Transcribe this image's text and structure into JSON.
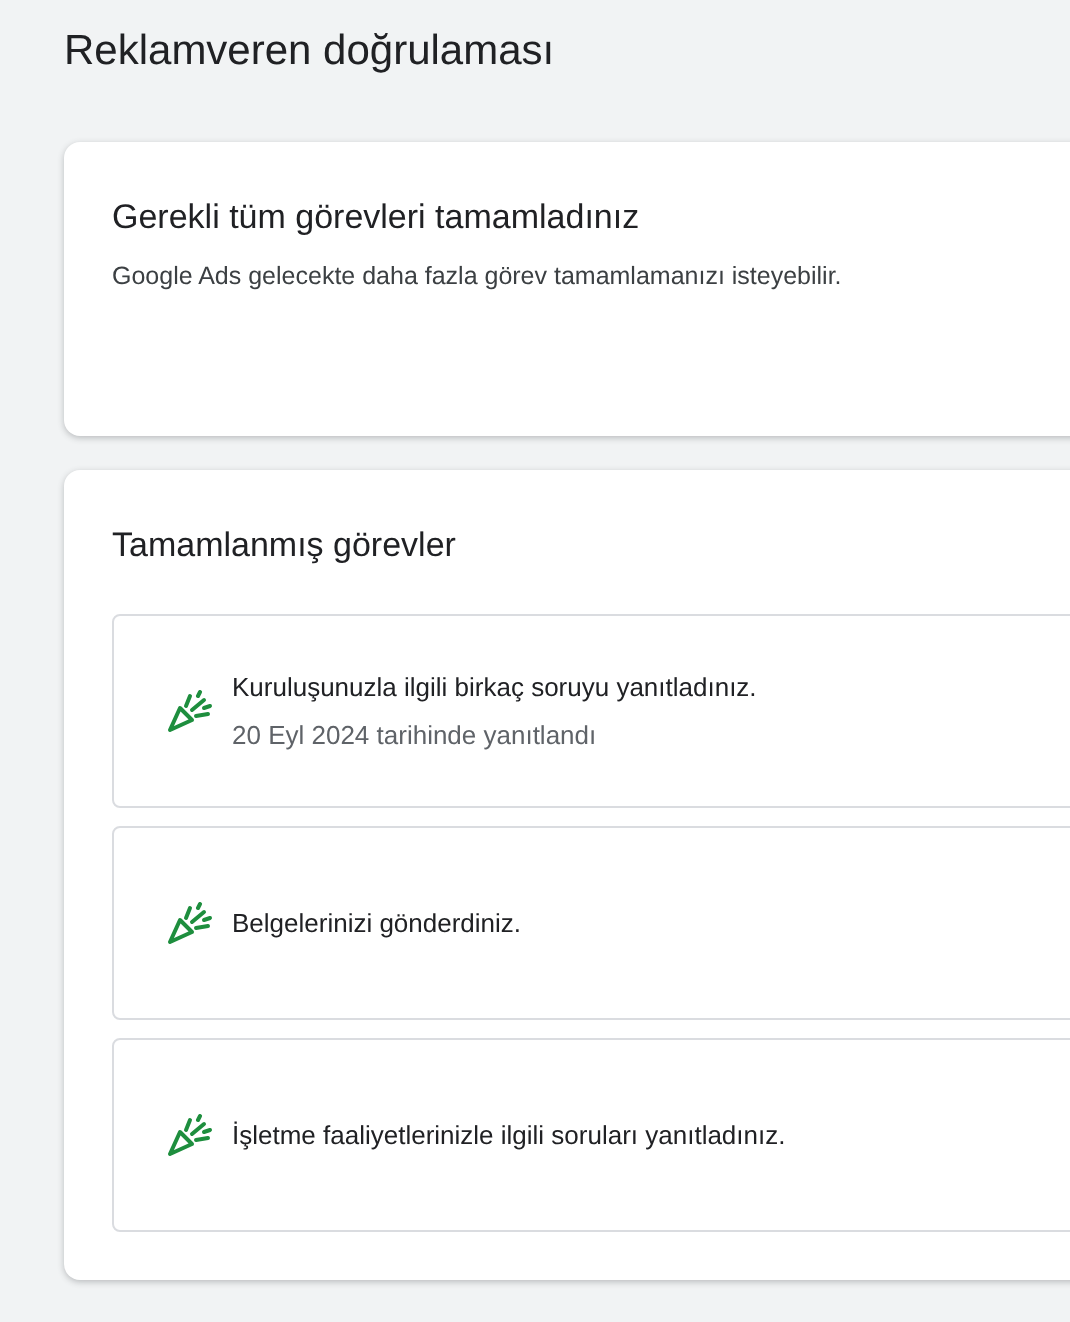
{
  "page_title": "Reklamveren doğrulaması",
  "status_card": {
    "title": "Gerekli tüm görevleri tamamladınız",
    "description": "Google Ads gelecekte daha fazla görev tamamlamanızı isteyebilir."
  },
  "completed_tasks": {
    "title": "Tamamlanmış görevler",
    "items": [
      {
        "text": "Kuruluşunuzla ilgili birkaç soruyu yanıtladınız.",
        "subtext": "20 Eyl 2024 tarihinde yanıtlandı"
      },
      {
        "text": "Belgelerinizi gönderdiniz."
      },
      {
        "text": "İşletme faaliyetlerinizle ilgili soruları yanıtladınız."
      }
    ]
  }
}
